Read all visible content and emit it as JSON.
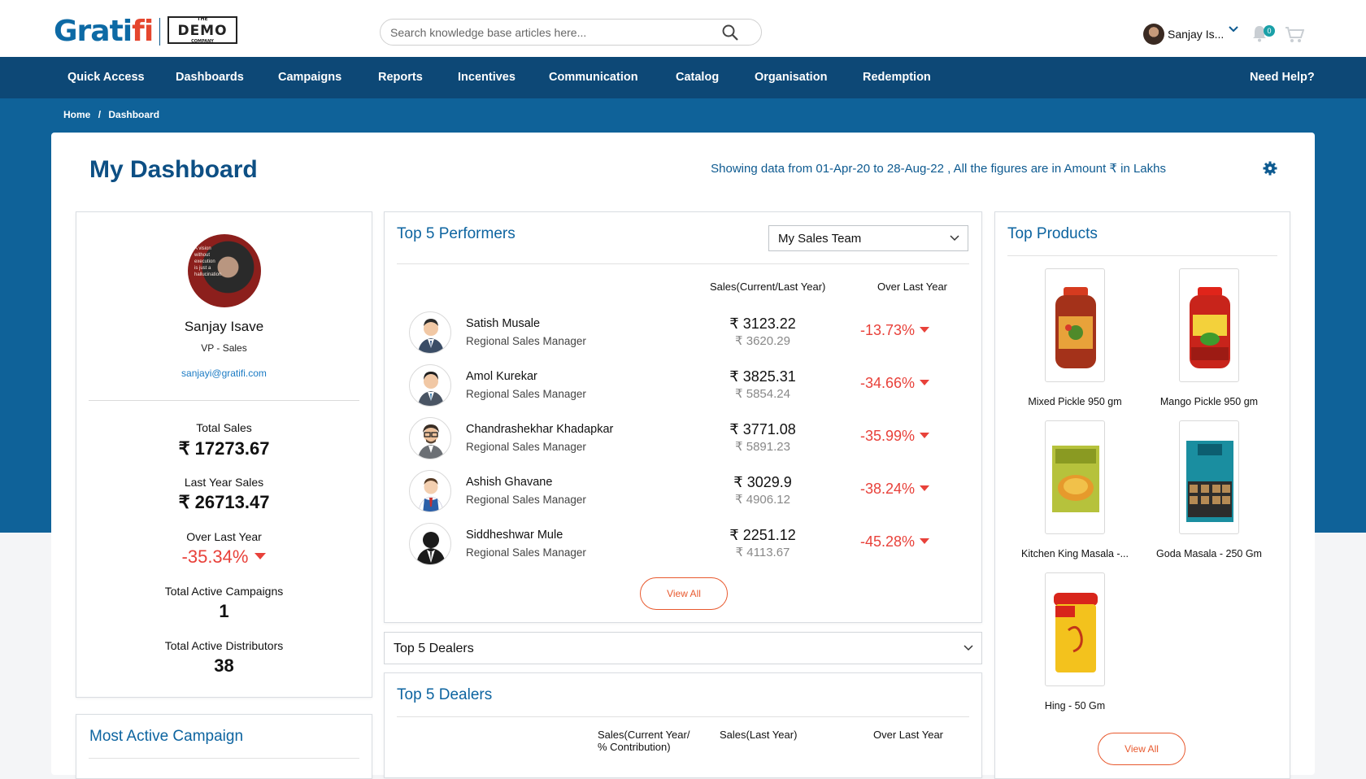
{
  "brand": {
    "logo_text_a": "Grati",
    "logo_text_b": "fi",
    "partner_the": "THE",
    "partner_name": "DEMO",
    "partner_sub": "COMPANY"
  },
  "search": {
    "placeholder": "Search knowledge base articles here..."
  },
  "user": {
    "name": "Sanjay Is...",
    "notifications": "0"
  },
  "nav": {
    "items": [
      "Quick Access",
      "Dashboards",
      "Campaigns",
      "Reports",
      "Incentives",
      "Communication",
      "Catalog",
      "Organisation",
      "Redemption"
    ],
    "help": "Need Help?"
  },
  "breadcrumb": {
    "home": "Home",
    "sep": "/",
    "current": "Dashboard"
  },
  "dashboard": {
    "title": "My Dashboard",
    "data_note": "Showing data from 01-Apr-20 to 28-Aug-22 , All the figures are in Amount ₹ in Lakhs"
  },
  "profile": {
    "name": "Sanjay Isave",
    "role": "VP - Sales",
    "email": "sanjayi@gratifi.com",
    "photo_text": "A vision without execution is just a hallucination",
    "total_sales_label": "Total Sales",
    "total_sales": "₹ 17273.67",
    "last_year_label": "Last Year Sales",
    "last_year": "₹ 26713.47",
    "over_label": "Over Last Year",
    "over_value": "-35.34%",
    "campaigns_label": "Total Active Campaigns",
    "campaigns_value": "1",
    "distributors_label": "Total Active Distributors",
    "distributors_value": "38"
  },
  "campaign_panel": {
    "title": "Most Active Campaign"
  },
  "performers": {
    "title": "Top 5 Performers",
    "team_select": "My Sales Team",
    "col_sales": "Sales(Current/Last Year)",
    "col_over": "Over Last Year",
    "rows": [
      {
        "name": "Satish Musale",
        "role": "Regional Sales Manager",
        "current": "₹ 3123.22",
        "previous": "₹ 3620.29",
        "change": "-13.73%"
      },
      {
        "name": "Amol Kurekar",
        "role": "Regional Sales Manager",
        "current": "₹ 3825.31",
        "previous": "₹ 5854.24",
        "change": "-34.66%"
      },
      {
        "name": "Chandrashekhar Khadapkar",
        "role": "Regional Sales Manager",
        "current": "₹ 3771.08",
        "previous": "₹ 5891.23",
        "change": "-35.99%"
      },
      {
        "name": "Ashish Ghavane",
        "role": "Regional Sales Manager",
        "current": "₹ 3029.9",
        "previous": "₹ 4906.12",
        "change": "-38.24%"
      },
      {
        "name": "Siddheshwar Mule",
        "role": "Regional Sales Manager",
        "current": "₹ 2251.12",
        "previous": "₹ 4113.67",
        "change": "-45.28%"
      }
    ],
    "view_all": "View All"
  },
  "dealers_select": {
    "label": "Top 5 Dealers"
  },
  "dealers": {
    "title": "Top 5 Dealers",
    "col_sales_a": "Sales(Current Year/",
    "col_sales_b": "% Contribution)",
    "col_last": "Sales(Last Year)",
    "col_over": "Over Last Year"
  },
  "products": {
    "title": "Top Products",
    "items": [
      {
        "name": "Mixed Pickle 950 gm"
      },
      {
        "name": "Mango Pickle 950 gm"
      },
      {
        "name": "Kitchen King Masala -..."
      },
      {
        "name": "Goda Masala - 250 Gm"
      },
      {
        "name": "Hing - 50 Gm"
      }
    ],
    "view_all": "View All"
  },
  "colors": {
    "nav_bg": "#0d4876",
    "hero_bg": "#0f6299",
    "title": "#0d4f84",
    "negative": "#e8413a",
    "accent_button": "#e8592e"
  }
}
